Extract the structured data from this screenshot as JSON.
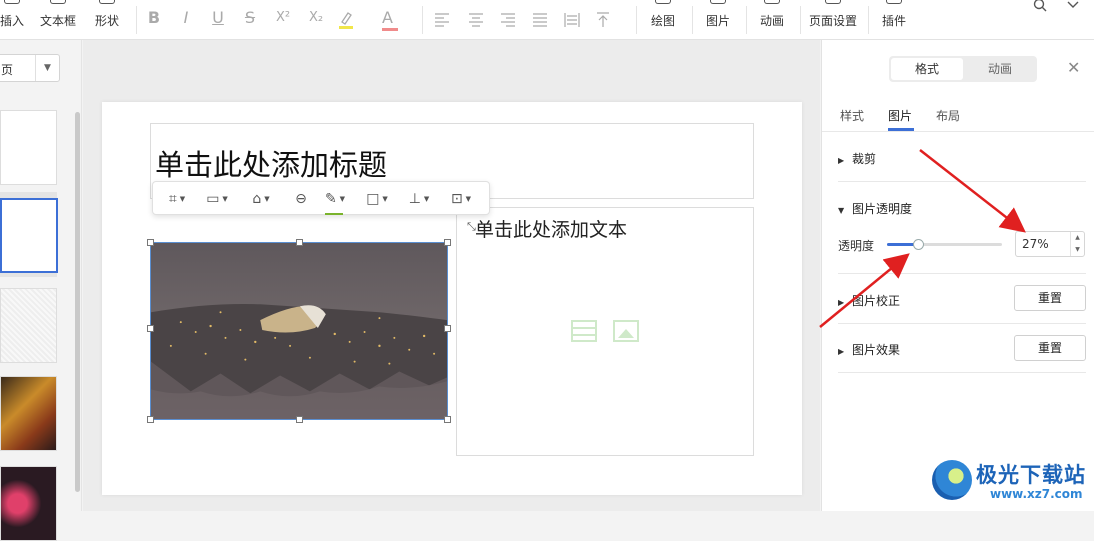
{
  "toolbar": {
    "items": [
      {
        "label": "插入"
      },
      {
        "label": "文本框"
      },
      {
        "label": "形状"
      },
      {
        "label": "绘图"
      },
      {
        "label": "图片"
      },
      {
        "label": "动画"
      },
      {
        "label": "页面设置"
      },
      {
        "label": "插件"
      }
    ],
    "format": {
      "bold": "B",
      "italic": "I",
      "underline": "U",
      "strike": "S",
      "superscript": "X²",
      "subscript": "X₂",
      "font_color": "A"
    }
  },
  "left_panel": {
    "dropdown_value": "页"
  },
  "slide": {
    "title_placeholder": "单击此处添加标题",
    "body_placeholder": "单击此处添加文本"
  },
  "right_panel": {
    "top_tabs": [
      "格式",
      "动画"
    ],
    "sub_tabs": [
      "样式",
      "图片",
      "布局"
    ],
    "active_sub_tab": "图片",
    "sections": {
      "crop": "裁剪",
      "transparency": "图片透明度",
      "correction": "图片校正",
      "effects": "图片效果"
    },
    "slider_label": "透明度",
    "transparency_percent": 27,
    "transparency_value": "27%",
    "reset_label": "重置"
  },
  "watermark": {
    "name": "极光下载站",
    "url": "www.xz7.com"
  },
  "colors": {
    "accent": "#3c6fd6",
    "arrow": "#e02020",
    "selection": "#5a8fd1"
  }
}
